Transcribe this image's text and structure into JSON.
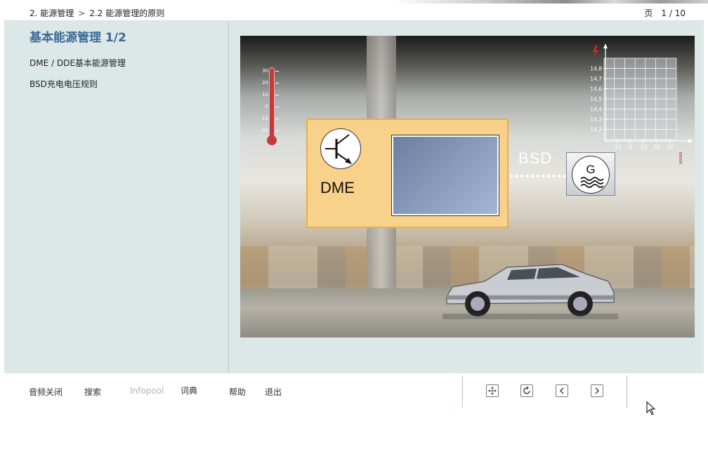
{
  "breadcrumb": {
    "level1": "2. 能源管理",
    "separator": ">",
    "level2": "2.2 能源管理的原则"
  },
  "pager": {
    "label": "页",
    "value": "1 / 10"
  },
  "sidebar": {
    "title": "基本能源管理 1/2",
    "links": [
      {
        "label": "DME / DDE基本能源管理"
      },
      {
        "label": "BSD充电电压规则"
      }
    ]
  },
  "illustration": {
    "dme_label": "DME",
    "bsd_label": "BSD",
    "generator_label": "G",
    "thermometer_ticks": [
      "30",
      "20",
      "10",
      "0",
      "-10",
      "-20"
    ],
    "chart_data": {
      "type": "line",
      "title": "",
      "xlabel": "",
      "ylabel": "",
      "x_ticks": [
        "-10",
        "0",
        "10",
        "20",
        "30"
      ],
      "y_ticks": [
        "14,8",
        "14,7",
        "14,6",
        "14,5",
        "14,4",
        "14,3",
        "14,2"
      ],
      "xlim": [
        -20,
        35
      ],
      "ylim": [
        14.1,
        14.9
      ],
      "grid": true,
      "series": []
    }
  },
  "toolbar": {
    "audio_off": "音频关闭",
    "search": "搜索",
    "infopool": "Infopool",
    "dictionary": "词典",
    "help": "帮助",
    "exit": "退出"
  },
  "colors": {
    "content_bg": "#dce7e8",
    "title_blue": "#3a6a96",
    "dme_box": "#f8d18a",
    "disabled_text": "#aab4b8"
  }
}
